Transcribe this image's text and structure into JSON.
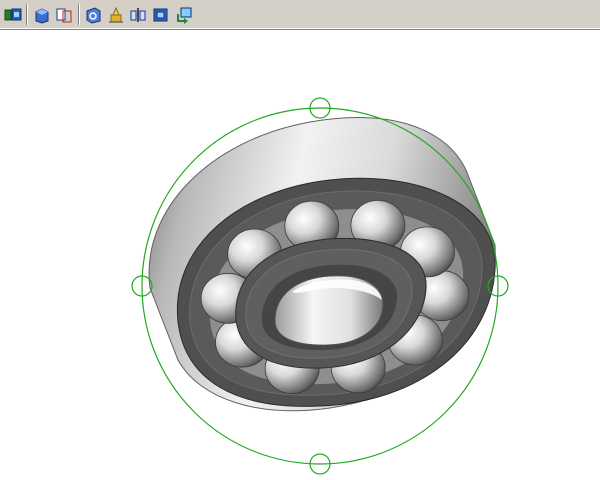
{
  "toolbar": {
    "buttons": [
      {
        "name": "view-orientation-icon"
      },
      {
        "name": "shaded-view-icon"
      },
      {
        "name": "hidden-lines-view-icon"
      },
      {
        "name": "wireframe-view-icon"
      },
      {
        "name": "lighting-icon"
      },
      {
        "name": "section-view-icon"
      },
      {
        "name": "zoom-to-fit-icon"
      },
      {
        "name": "rotate-view-icon"
      }
    ]
  },
  "colors": {
    "toolbar_bg": "#d4d0c8",
    "triad_ring": "#22aa22",
    "ring_dark": "#555555",
    "ring_light": "#e6e6e6"
  },
  "model": {
    "name": "deep-groove-ball-bearing",
    "ball_count": 10
  }
}
